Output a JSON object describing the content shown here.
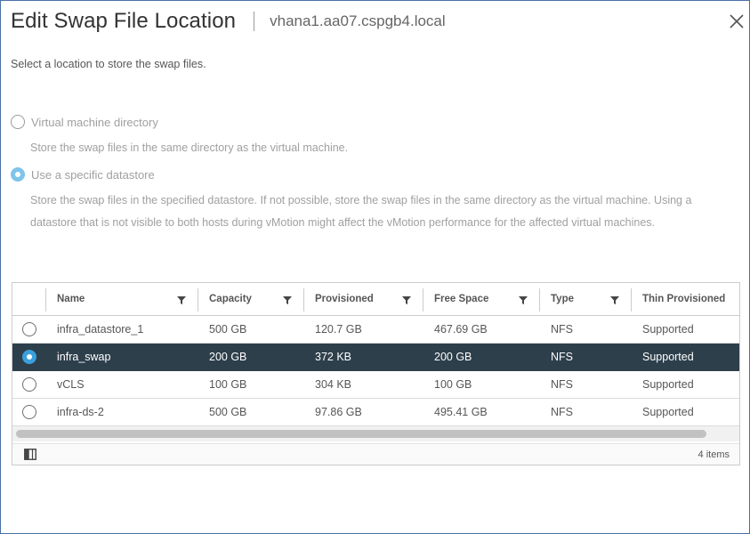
{
  "dialog": {
    "title": "Edit Swap File Location",
    "subtitle": "vhana1.aa07.cspgb4.local",
    "close_icon": "close-icon",
    "instruction": "Select a location to store the swap files."
  },
  "options": [
    {
      "label": "Virtual machine directory",
      "description": "Store the swap files in the same directory as the virtual machine.",
      "selected": false
    },
    {
      "label": "Use a specific datastore",
      "description": "Store the swap files in the specified datastore. If not possible, store the swap files in the same directory as the virtual machine. Using a datastore that is not visible to both hosts during vMotion might affect the vMotion performance for the affected virtual machines.",
      "selected": true
    }
  ],
  "datagrid": {
    "columns": [
      "Name",
      "Capacity",
      "Provisioned",
      "Free Space",
      "Type",
      "Thin Provisioned"
    ],
    "filter_icon": "filter-icon",
    "rows": [
      {
        "name": "infra_datastore_1",
        "capacity": "500 GB",
        "provisioned": "120.7 GB",
        "free_space": "467.69 GB",
        "type": "NFS",
        "thin_provisioned": "Supported",
        "selected": false
      },
      {
        "name": "infra_swap",
        "capacity": "200 GB",
        "provisioned": "372 KB",
        "free_space": "200 GB",
        "type": "NFS",
        "thin_provisioned": "Supported",
        "selected": true
      },
      {
        "name": "vCLS",
        "capacity": "100 GB",
        "provisioned": "304 KB",
        "free_space": "100 GB",
        "type": "NFS",
        "thin_provisioned": "Supported",
        "selected": false
      },
      {
        "name": "infra-ds-2",
        "capacity": "500 GB",
        "provisioned": "97.86 GB",
        "free_space": "495.41 GB",
        "type": "NFS",
        "thin_provisioned": "Supported",
        "selected": false
      }
    ],
    "footer": {
      "column_toggle_icon": "column-toggle-icon",
      "item_count": "4 items"
    }
  },
  "colors": {
    "selected_row_bg": "#2e3f4c",
    "radio_accent": "#3aa0dd",
    "disabled_radio_accent": "#7fc4ea",
    "frame_border": "#4a6fa5"
  }
}
